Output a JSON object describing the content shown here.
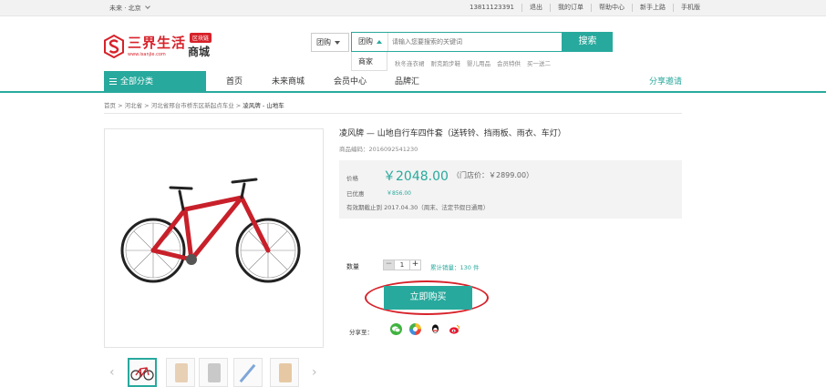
{
  "topbar": {
    "location": "未来 · 北京",
    "links": [
      "13811123391",
      "退出",
      "我的订单",
      "帮助中心",
      "新手上路",
      "手机版"
    ]
  },
  "logo": {
    "name": "三界生活",
    "badge": "区块链",
    "mall": "商城",
    "url": "www.isanjie.com"
  },
  "search": {
    "category": "团购",
    "type": "团购",
    "placeholder": "请输入您要搜索的关键词",
    "button": "搜索",
    "dropdown_option": "商家",
    "hot_words": [
      "秋冬连衣裙",
      "耐克跑步鞋",
      "婴儿用品",
      "会员特供",
      "买一送二"
    ]
  },
  "nav": {
    "category_label": "全部分类",
    "items": [
      "首页",
      "未来商城",
      "会员中心",
      "品牌汇"
    ],
    "share": "分享邀请"
  },
  "breadcrumb": {
    "items": [
      "首页",
      "河北省",
      "河北省邢台市桥东区新起点车业"
    ],
    "current": "凌风牌 - 山地车"
  },
  "product": {
    "title": "凌风牌 — 山地自行车四件套（送转铃、挡雨板、雨衣、车灯）",
    "code": "商品编码：2016092541230",
    "price_label": "价格",
    "price": "￥2048.00",
    "store_price": "（门店价：￥2899.00）",
    "saved_label": "已优惠",
    "saved": "￥856.00",
    "valid": "有效期截止到 2017.04.30（周末、法定节假日通用）",
    "qty_label": "数量",
    "qty": "1",
    "minus": "−",
    "plus": "+",
    "sold": "累计销量：130 件",
    "buy": "立即购买",
    "share_label": "分享至："
  },
  "colors": {
    "accent": "#28a99d",
    "brand_red": "#d7222a"
  },
  "icons": {
    "share": [
      "wechat-icon",
      "moments-icon",
      "qq-icon",
      "weibo-icon"
    ],
    "thumb_prev": "‹",
    "thumb_next": "›"
  }
}
